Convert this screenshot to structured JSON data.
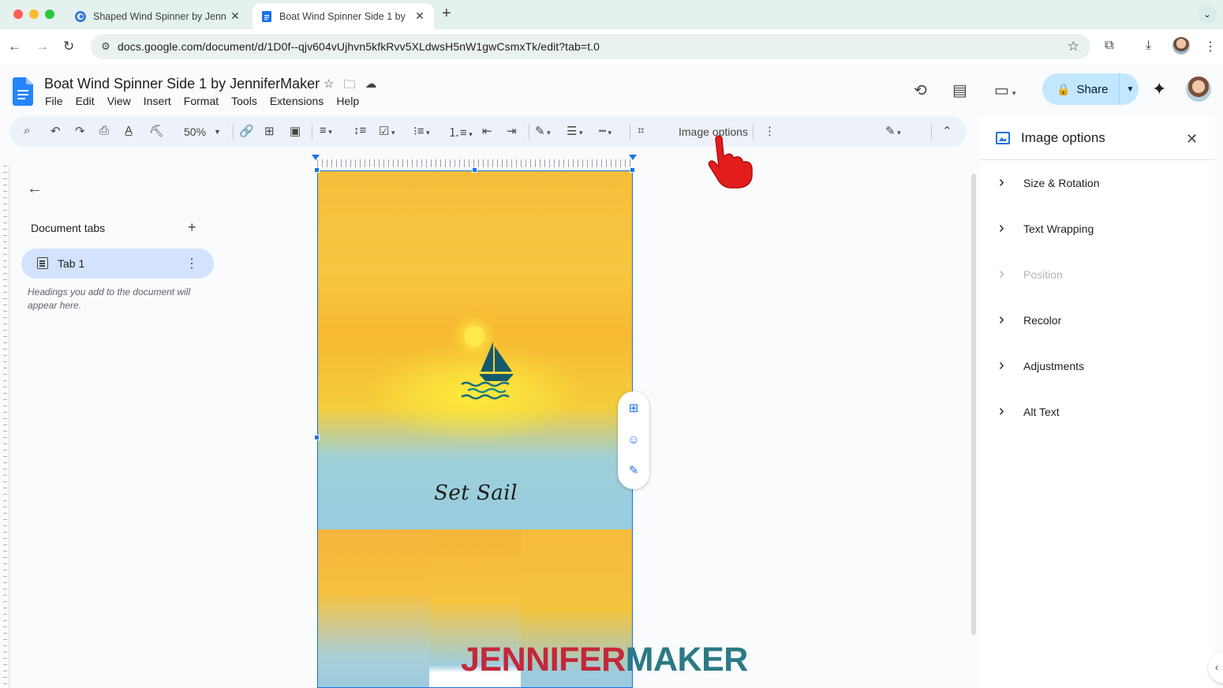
{
  "browser": {
    "tabs": [
      {
        "title": "Shaped Wind Spinner by Jenn",
        "active": false
      },
      {
        "title": "Boat Wind Spinner Side 1 by",
        "active": true
      }
    ],
    "url": "docs.google.com/document/d/1D0f--qjv604vUjhvn5kfkRvv5XLdwsH5nW1gwCsmxTk/edit?tab=t.0"
  },
  "doc": {
    "title": "Boat Wind Spinner Side 1 by JenniferMaker",
    "menu": [
      "File",
      "Edit",
      "View",
      "Insert",
      "Format",
      "Tools",
      "Extensions",
      "Help"
    ],
    "share_label": "Share"
  },
  "toolbar": {
    "zoom": "50%",
    "image_options_label": "Image options"
  },
  "outline": {
    "section_label": "Document tabs",
    "tab_label": "Tab 1",
    "hint": "Headings you add to the document will appear here."
  },
  "image": {
    "caption": "Set Sail"
  },
  "side_panel": {
    "title": "Image options",
    "items": [
      {
        "label": "Size & Rotation",
        "enabled": true
      },
      {
        "label": "Text Wrapping",
        "enabled": true
      },
      {
        "label": "Position",
        "enabled": false
      },
      {
        "label": "Recolor",
        "enabled": true
      },
      {
        "label": "Adjustments",
        "enabled": true
      },
      {
        "label": "Alt Text",
        "enabled": true
      }
    ]
  },
  "watermark": {
    "part1": "JENNIFER",
    "part2": "MAKER"
  },
  "colors": {
    "accent": "#1a73e8",
    "share_bg": "#c2e7ff",
    "tab_active_bg": "#d3e3fd",
    "watermark_red": "#c4283b",
    "watermark_teal": "#2b7a83"
  }
}
